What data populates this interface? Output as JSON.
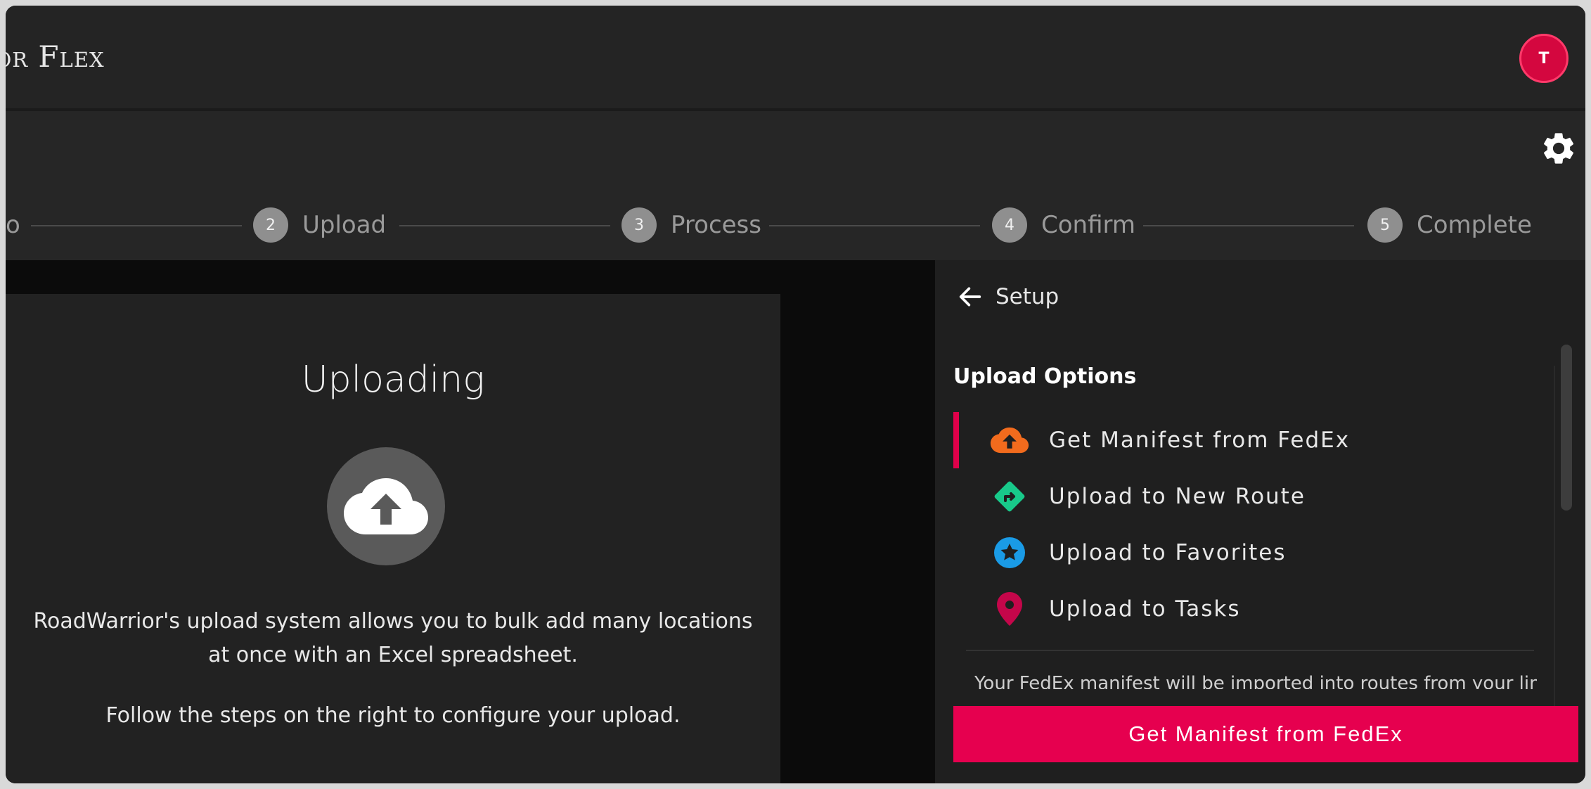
{
  "app": {
    "brand": "ior Flex",
    "avatar_initial": "T"
  },
  "stepper": {
    "steps": [
      {
        "number": "",
        "label": "o"
      },
      {
        "number": "2",
        "label": "Upload"
      },
      {
        "number": "3",
        "label": "Process"
      },
      {
        "number": "4",
        "label": "Confirm"
      },
      {
        "number": "5",
        "label": "Complete"
      }
    ]
  },
  "main": {
    "title": "Uploading",
    "description_line1": "RoadWarrior's upload system allows you to bulk add many locations",
    "description_line2": "at once with an Excel spreadsheet.",
    "instruction": "Follow the steps on the right to configure your upload."
  },
  "panel": {
    "back_label": "Setup",
    "section_label": "Upload Options",
    "options": [
      {
        "label": "Get Manifest from FedEx",
        "icon": "cloud-upload-icon",
        "color": "#f26b1d",
        "selected": true
      },
      {
        "label": "Upload to New Route",
        "icon": "route-sign-icon",
        "color": "#18c98a",
        "selected": false
      },
      {
        "label": "Upload to Favorites",
        "icon": "star-icon",
        "color": "#1a9be6",
        "selected": false
      },
      {
        "label": "Upload to Tasks",
        "icon": "map-pin-icon",
        "color": "#c4064a",
        "selected": false
      }
    ],
    "description": "Your FedEx manifest will be imported into routes from your linked",
    "primary_button": "Get Manifest from FedEx"
  },
  "colors": {
    "accent": "#e6004f",
    "background": "#262626",
    "panel": "#1f1f1f"
  }
}
